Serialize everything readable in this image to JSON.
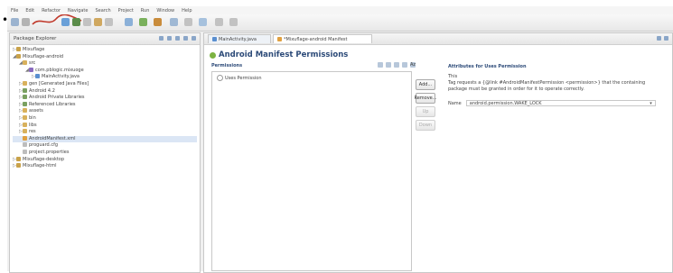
{
  "menubar": [
    "File",
    "Edit",
    "Refactor",
    "Navigate",
    "Search",
    "Project",
    "Run",
    "Window",
    "Help"
  ],
  "package_explorer": {
    "title": "Package Explorer",
    "tree": [
      {
        "indent": 0,
        "twisty": "▷",
        "icon": "project-icon",
        "label": "Mixuflage"
      },
      {
        "indent": 0,
        "twisty": "◢",
        "icon": "project-icon",
        "label": "Mixuflage-android"
      },
      {
        "indent": 1,
        "twisty": "◢",
        "icon": "folder-icon",
        "label": "src"
      },
      {
        "indent": 2,
        "twisty": "◢",
        "icon": "package-icon",
        "label": "com.pblogic.mixuoge"
      },
      {
        "indent": 3,
        "twisty": "▷",
        "icon": "java-icon",
        "label": "MainActivity.java"
      },
      {
        "indent": 1,
        "twisty": "▷",
        "icon": "folder-icon",
        "label": "gen [Generated Java Files]"
      },
      {
        "indent": 1,
        "twisty": "▷",
        "icon": "library-icon",
        "label": "Android 4.2"
      },
      {
        "indent": 1,
        "twisty": "▷",
        "icon": "library-icon",
        "label": "Android Private Libraries"
      },
      {
        "indent": 1,
        "twisty": "▷",
        "icon": "library-icon",
        "label": "Referenced Libraries"
      },
      {
        "indent": 1,
        "twisty": "▷",
        "icon": "folder-icon",
        "label": "assets"
      },
      {
        "indent": 1,
        "twisty": "▷",
        "icon": "folder-icon",
        "label": "bin"
      },
      {
        "indent": 1,
        "twisty": "▷",
        "icon": "folder-icon",
        "label": "libs"
      },
      {
        "indent": 1,
        "twisty": "▷",
        "icon": "folder-icon",
        "label": "res"
      },
      {
        "indent": 1,
        "twisty": "",
        "icon": "xml-icon",
        "label": "AndroidManifest.xml",
        "selected": true
      },
      {
        "indent": 1,
        "twisty": "",
        "icon": "file-icon",
        "label": "proguard.cfg"
      },
      {
        "indent": 1,
        "twisty": "",
        "icon": "file-icon",
        "label": "project.properties"
      },
      {
        "indent": 0,
        "twisty": "▷",
        "icon": "project-icon",
        "label": "Mixuflage-desktop"
      },
      {
        "indent": 0,
        "twisty": "▷",
        "icon": "project-icon",
        "label": "Mixuflage-html"
      }
    ]
  },
  "editor": {
    "tabs": [
      {
        "label": "MainActivity.java",
        "active": false
      },
      {
        "label": "*Mixuflage-android Manifest",
        "active": true
      }
    ],
    "form_title": "Android Manifest Permissions",
    "permissions_label": "Permissions",
    "permission_item": "Uses Permission",
    "sort_label": "Az",
    "buttons": {
      "add": "Add...",
      "remove": "Remove...",
      "up": "Up",
      "down": "Down"
    },
    "attributes_label": "Attributes for Uses Permission",
    "attributes_subtitle": "This",
    "attributes_desc": "Tag requests a {@link #AndroidManifestPermission <permission>} that the containing package must be granted in order for it to operate correctly.",
    "name_label": "Name",
    "name_value": "android.permission.WAKE_LOCK"
  },
  "colors": {
    "accent": "#2c4a78",
    "selection": "#dbe6f5",
    "annotation": "#c0392b"
  }
}
